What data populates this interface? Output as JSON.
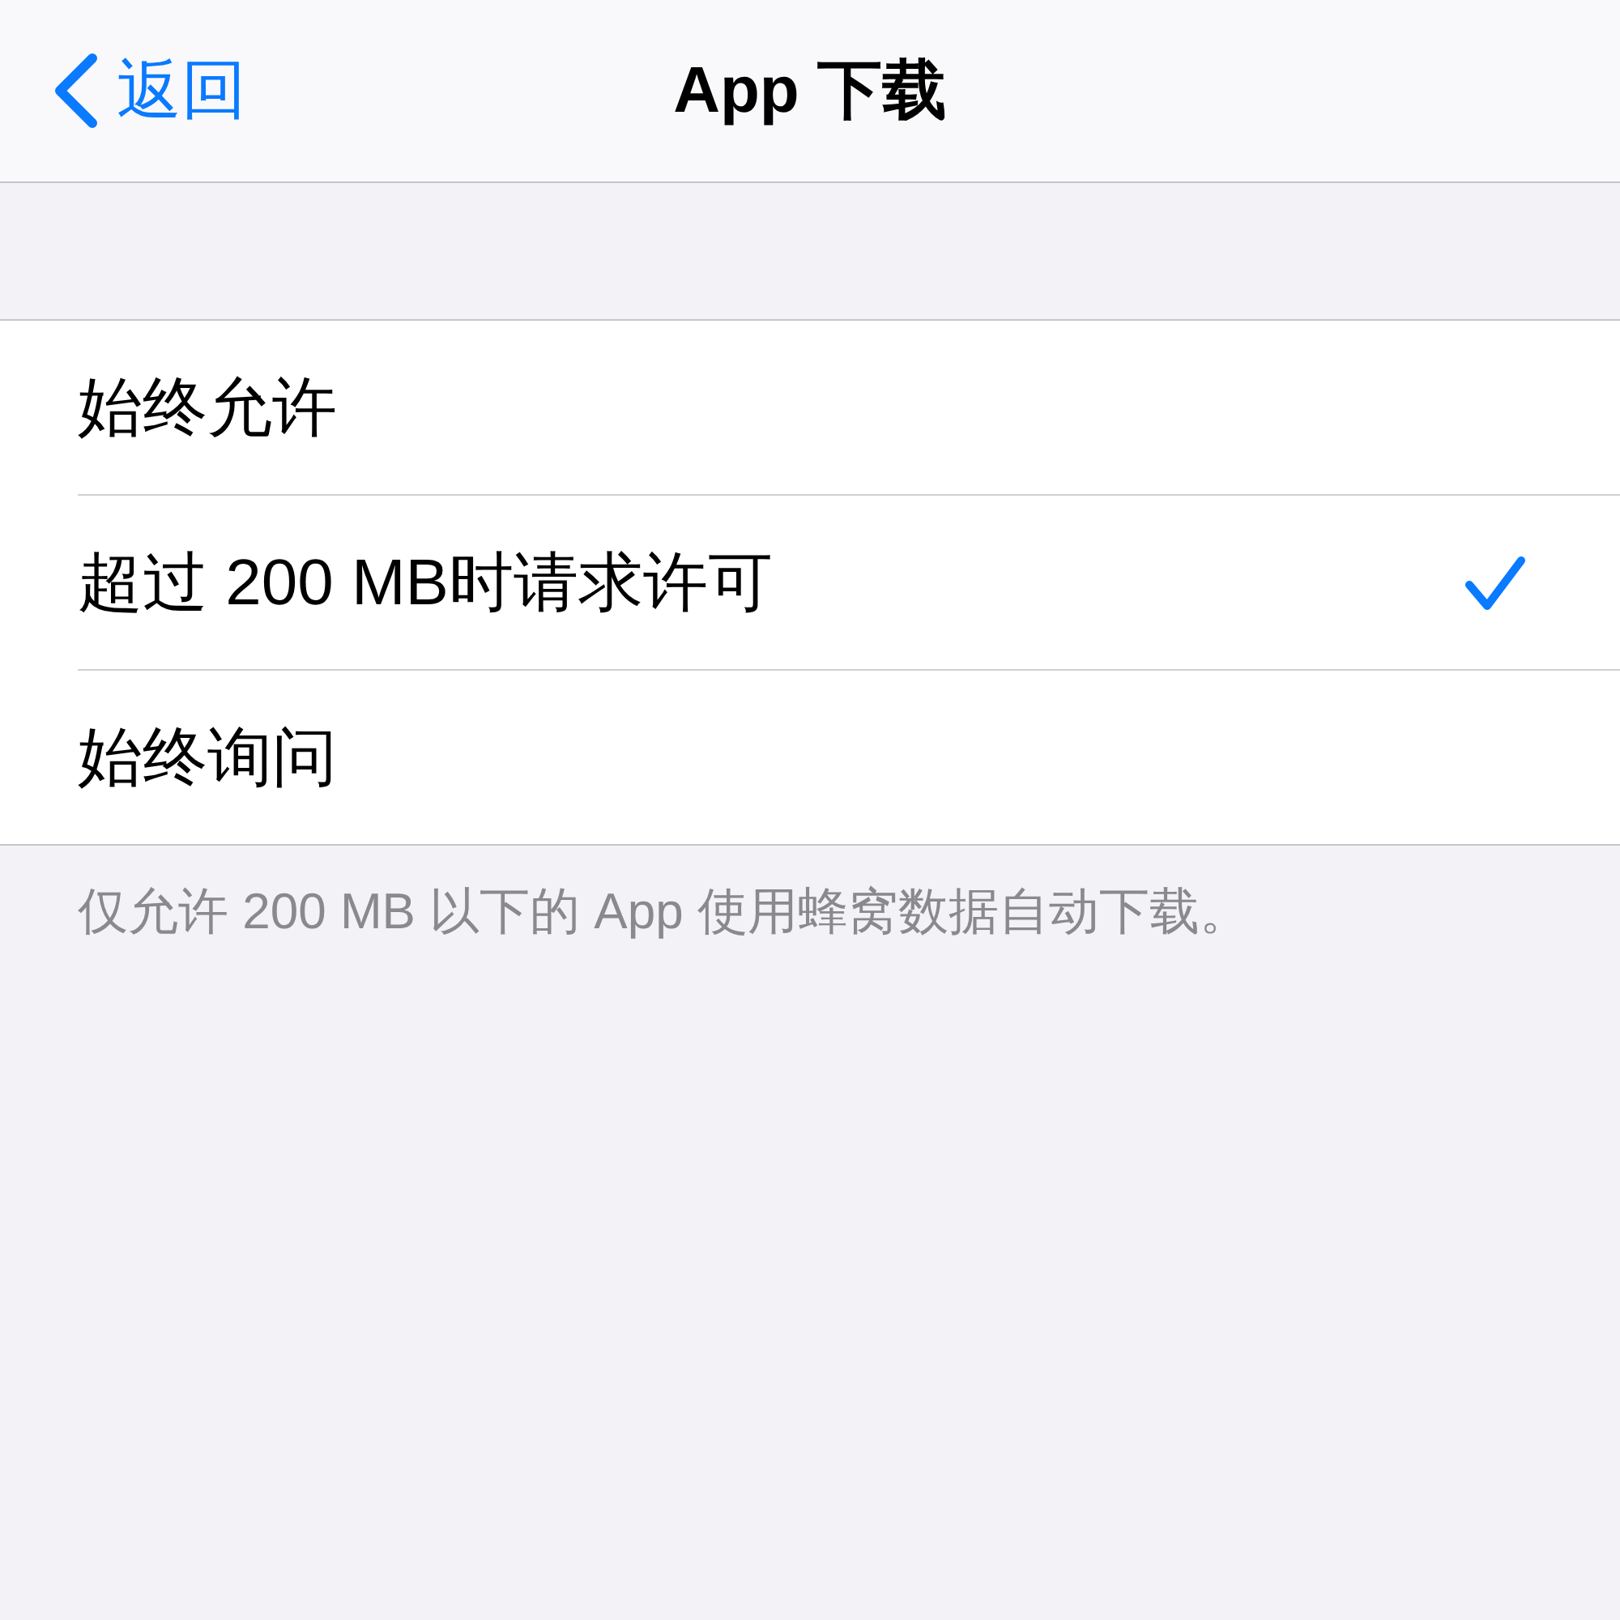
{
  "nav": {
    "back": {
      "label": "返回"
    },
    "title": "App 下载"
  },
  "options": [
    {
      "label": "始终允许",
      "selected": false
    },
    {
      "label": "超过 200 MB时请求许可",
      "selected": true
    },
    {
      "label": "始终询问",
      "selected": false
    }
  ],
  "footer_note": "仅允许 200 MB 以下的 App 使用蜂窝数据自动下载。"
}
